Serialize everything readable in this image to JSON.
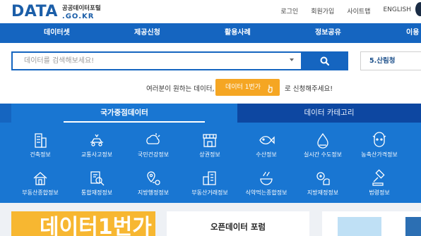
{
  "logo": {
    "main": "DATA",
    "sub_ko": "공공데이터포털",
    "sub_en": ".GO.KR"
  },
  "top_links": [
    "로그인",
    "회원가입",
    "사이트맵",
    "ENGLISH"
  ],
  "nav": [
    "데이터셋",
    "제공신청",
    "활용사례",
    "정보공유",
    "이용"
  ],
  "search": {
    "placeholder": "데이터를 검색해보세요!",
    "rank_label": "5.산림청"
  },
  "request": {
    "before": "여러분이 원하는 데이터,",
    "button": "데이터 1번가",
    "after": "로 신청해주세요!"
  },
  "tabs": {
    "active": "국가중점데이터",
    "inactive": "데이터 카테고리"
  },
  "categories": [
    {
      "label": "건축정보",
      "icon": "building-icon"
    },
    {
      "label": "교통사고정보",
      "icon": "traffic-accident-icon"
    },
    {
      "label": "국민건강정보",
      "icon": "health-weather-icon"
    },
    {
      "label": "상권정보",
      "icon": "store-icon"
    },
    {
      "label": "수산정보",
      "icon": "fish-icon"
    },
    {
      "label": "실시간 수도정보",
      "icon": "water-drop-icon"
    },
    {
      "label": "농축산가격정보",
      "icon": "livestock-icon"
    },
    {
      "label": "부동산종합정보",
      "icon": "house-icon"
    },
    {
      "label": "통합재정정보",
      "icon": "finance-search-icon"
    },
    {
      "label": "지방행정정보",
      "icon": "location-pin-icon"
    },
    {
      "label": "부동산거래정보",
      "icon": "real-estate-trade-icon"
    },
    {
      "label": "식약먹는종합정보",
      "icon": "food-drug-icon"
    },
    {
      "label": "지방재정정보",
      "icon": "local-finance-icon"
    },
    {
      "label": "법령정보",
      "icon": "law-gavel-icon"
    }
  ],
  "bottom": {
    "forum_title": "오픈데이터 포럼",
    "promo_text": "데이터1번가"
  },
  "colors": {
    "primary": "#1565c0",
    "panel": "#1976d2",
    "dark_tab": "#0d47a1",
    "accent": "#f5a623",
    "logo": "#1b5ea8"
  }
}
